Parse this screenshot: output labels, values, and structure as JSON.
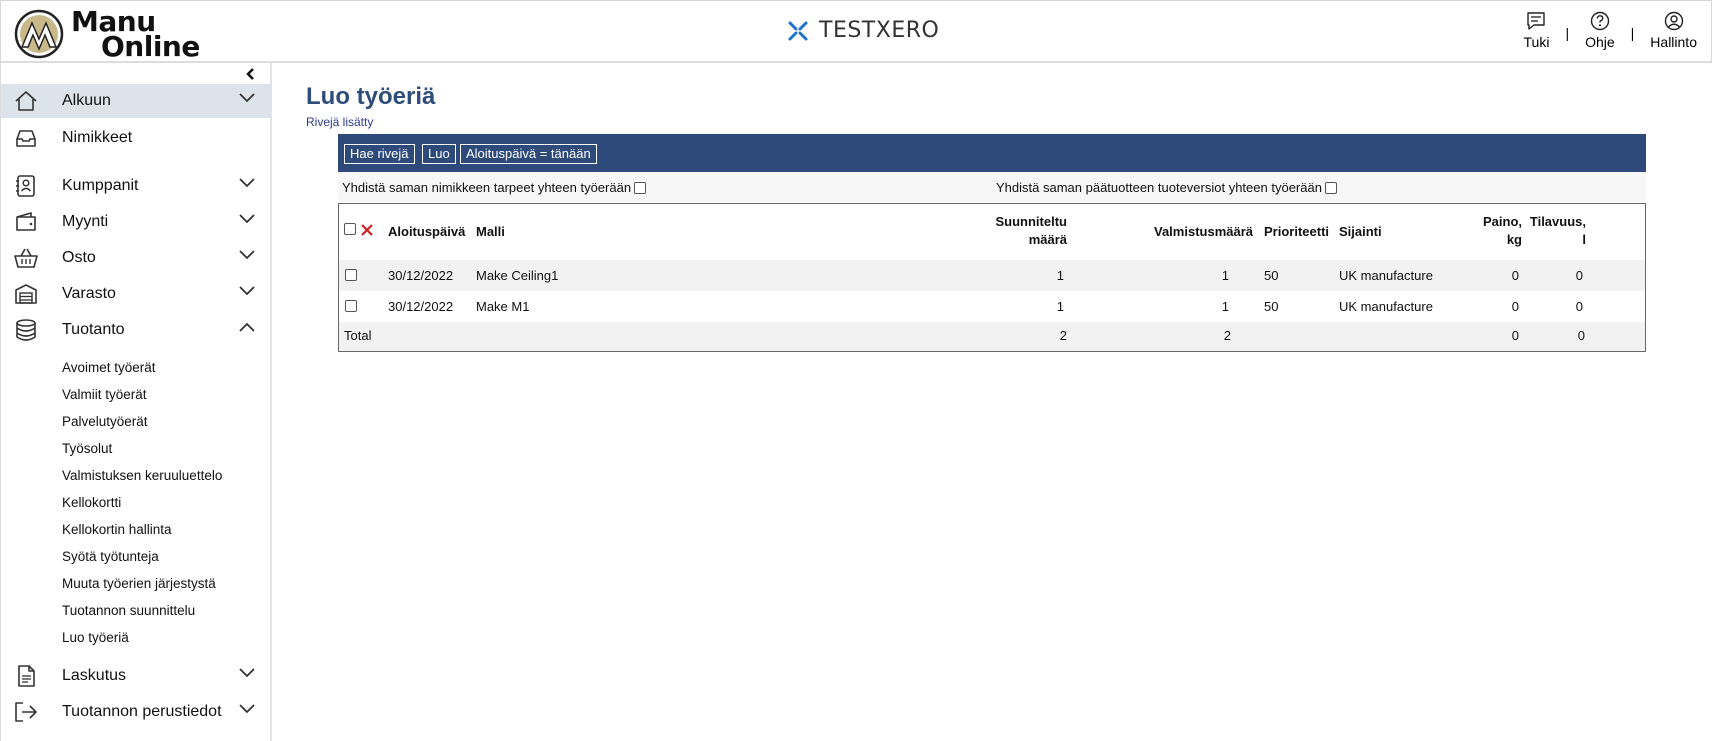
{
  "header": {
    "logo_line1": "Manu",
    "logo_line2": "Online",
    "company": "TESTXERO",
    "links": [
      {
        "label": "Tuki",
        "icon": "chat-icon"
      },
      {
        "label": "Ohje",
        "icon": "help-icon"
      },
      {
        "label": "Hallinto",
        "icon": "user-icon"
      }
    ],
    "separator": "|"
  },
  "sidebar": {
    "items": [
      {
        "label": "Alkuun",
        "icon": "home-icon",
        "expanded": false,
        "active": true
      },
      {
        "label": "Nimikkeet",
        "icon": "inbox-icon"
      },
      {
        "label": "Kumppanit",
        "icon": "contacts-icon",
        "expanded": false
      },
      {
        "label": "Myynti",
        "icon": "wallet-icon",
        "expanded": false
      },
      {
        "label": "Osto",
        "icon": "basket-icon",
        "expanded": false
      },
      {
        "label": "Varasto",
        "icon": "warehouse-icon",
        "expanded": false
      },
      {
        "label": "Tuotanto",
        "icon": "database-icon",
        "expanded": true
      },
      {
        "label": "Laskutus",
        "icon": "document-icon",
        "expanded": false
      },
      {
        "label": "Tuotannon perustiedot",
        "icon": "exit-icon",
        "expanded": false
      }
    ],
    "sub_items": [
      "Avoimet työerät",
      "Valmiit työerät",
      "Palvelutyöerät",
      "Työsolut",
      "Valmistuksen keruuluettelo",
      "Kellokortti",
      "Kellokortin hallinta",
      "Syötä työtunteja",
      "Muuta työerien järjestystä",
      "Tuotannon suunnittelu",
      "Luo työeriä"
    ]
  },
  "main": {
    "title": "Luo työeriä",
    "status": "Rivejä lisätty",
    "toolbar": {
      "fetch": "Hae rivejä",
      "create": "Luo",
      "start_today": "Aloituspäivä = tänään"
    },
    "options": {
      "merge_item": "Yhdistä saman nimikkeen tarpeet yhteen työerään",
      "merge_product": "Yhdistä saman päätuotteen tuoteversiot yhteen työerään"
    },
    "columns": {
      "start_date": "Aloituspäivä",
      "model": "Malli",
      "planned_l1": "Suunniteltu",
      "planned_l2": "määrä",
      "manufactured": "Valmistusmäärä",
      "priority": "Prioriteetti",
      "location": "Sijainti",
      "weight_l1": "Paino,",
      "weight_l2": "kg",
      "volume_l1": "Tilavuus,",
      "volume_l2": "l"
    },
    "rows": [
      {
        "start_date": "30/12/2022",
        "model": "Make Ceiling1",
        "planned": "1",
        "manufactured": "1",
        "priority": "50",
        "location": "UK manufacture",
        "weight": "0",
        "volume": "0"
      },
      {
        "start_date": "30/12/2022",
        "model": "Make M1",
        "planned": "1",
        "manufactured": "1",
        "priority": "50",
        "location": "UK manufacture",
        "weight": "0",
        "volume": "0"
      }
    ],
    "total": {
      "label": "Total",
      "planned": "2",
      "manufactured": "2",
      "weight": "0",
      "volume": "0"
    }
  },
  "colors": {
    "accent": "#2d4a7a",
    "title": "#2e4d7b",
    "active_nav": "#dde3ea",
    "delete": "#cc2222"
  }
}
